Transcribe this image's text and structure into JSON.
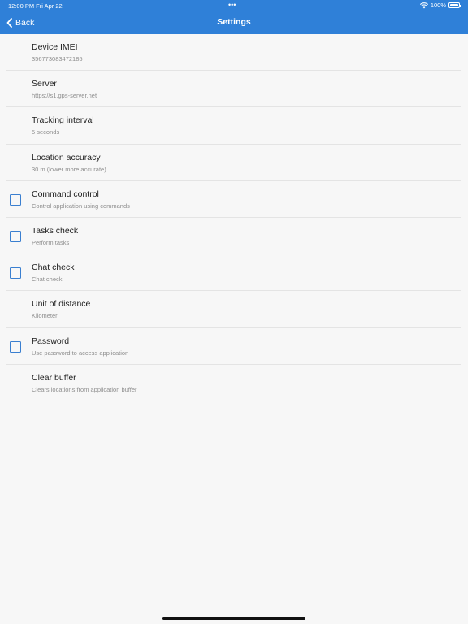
{
  "status_bar": {
    "time": "12:00 PM   Fri Apr 22",
    "dots": "•••",
    "battery": "100%"
  },
  "nav": {
    "back_label": "Back",
    "title": "Settings"
  },
  "settings": [
    {
      "title": "Device IMEI",
      "subtitle": "356773083472185",
      "checkbox": false
    },
    {
      "title": "Server",
      "subtitle": "https://s1.gps-server.net",
      "checkbox": false
    },
    {
      "title": "Tracking interval",
      "subtitle": "5 seconds",
      "checkbox": false
    },
    {
      "title": "Location accuracy",
      "subtitle": "30 m (lower more accurate)",
      "checkbox": false
    },
    {
      "title": "Command control",
      "subtitle": "Control application using commands",
      "checkbox": true,
      "checked": false
    },
    {
      "title": "Tasks check",
      "subtitle": "Perform tasks",
      "checkbox": true,
      "checked": false
    },
    {
      "title": "Chat check",
      "subtitle": "Chat check",
      "checkbox": true,
      "checked": false
    },
    {
      "title": "Unit of distance",
      "subtitle": "Kilometer",
      "checkbox": false
    },
    {
      "title": "Password",
      "subtitle": "Use password to access application",
      "checkbox": true,
      "checked": false
    },
    {
      "title": "Clear buffer",
      "subtitle": "Clears locations from application buffer",
      "checkbox": false
    }
  ],
  "colors": {
    "header": "#2f80d8",
    "checkbox_border": "#3a7fd0",
    "background": "#f7f7f7"
  }
}
